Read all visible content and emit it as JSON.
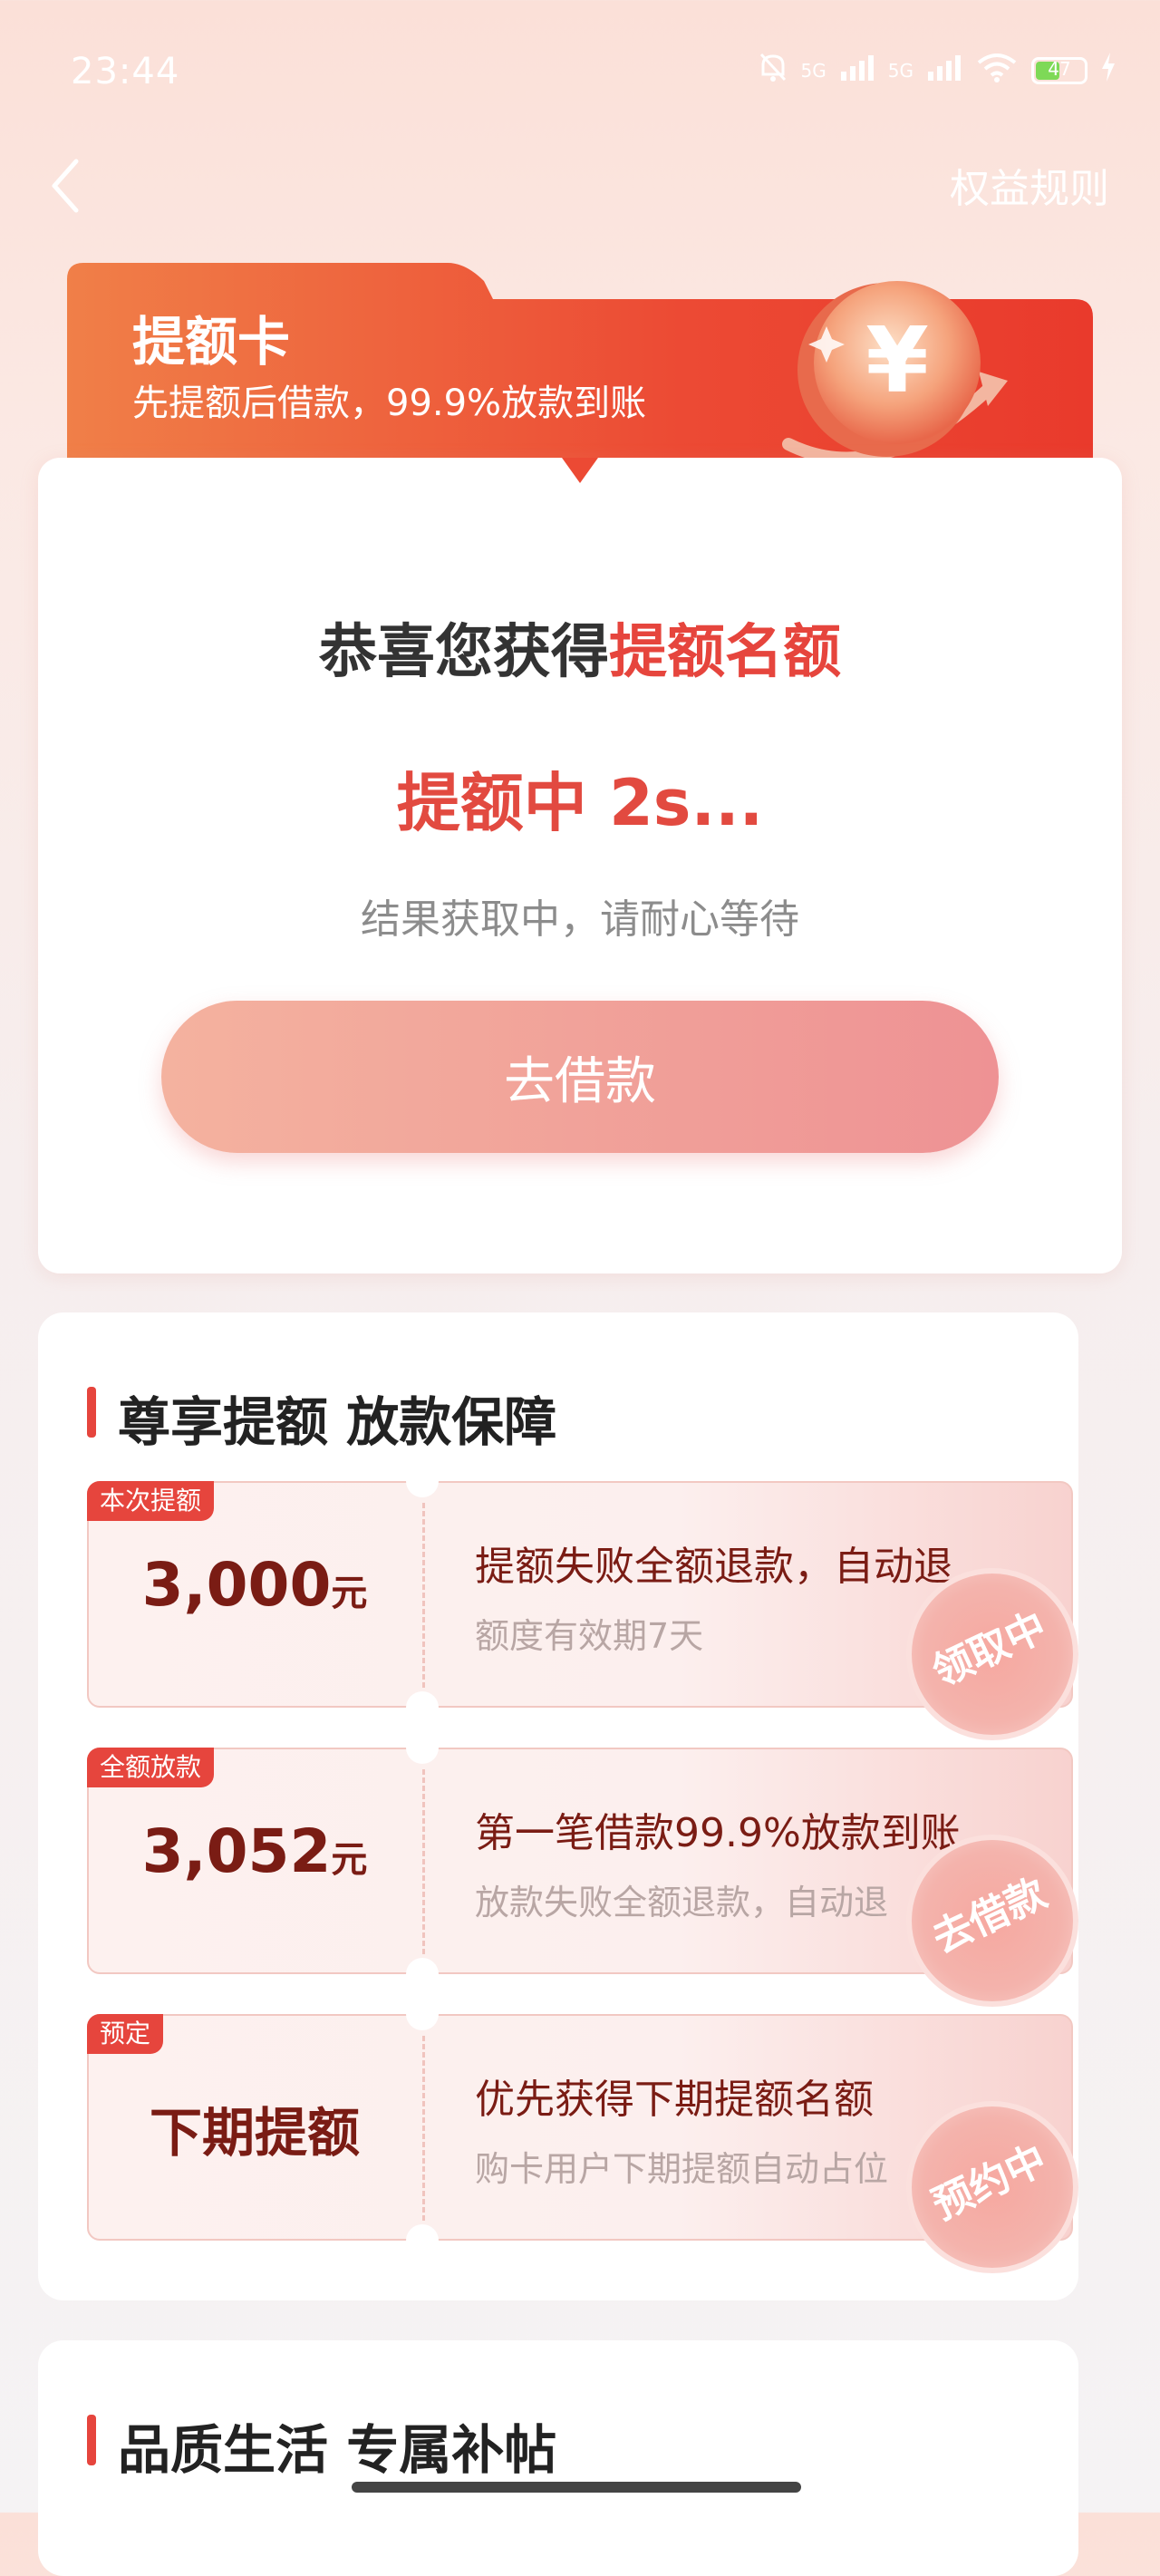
{
  "status_bar": {
    "time": "23:44",
    "network_1": "5G",
    "network_2": "5G",
    "battery": "47"
  },
  "nav": {
    "rules": "权益规则"
  },
  "header": {
    "title": "提额卡",
    "subtitle": "先提额后借款，99.9%放款到账"
  },
  "main": {
    "congrats_prefix": "恭喜您获得",
    "congrats_highlight": "提额名额",
    "status": "提额中 2s...",
    "hint": "结果获取中，请耐心等待",
    "button": "去借款"
  },
  "benefits": {
    "title": "尊享提额 放款保障",
    "tickets": [
      {
        "tag": "本次提额",
        "amount": "3,000",
        "unit": "元",
        "title": "提额失败全额退款，自动退",
        "desc": "额度有效期7天",
        "stamp": "领取中"
      },
      {
        "tag": "全额放款",
        "amount": "3,052",
        "unit": "元",
        "title": "第一笔借款99.9%放款到账",
        "desc": "放款失败全额退款，自动退",
        "stamp": "去借款"
      },
      {
        "tag": "预定",
        "amount": "下期提额",
        "unit": "",
        "title": "优先获得下期提额名额",
        "desc": "购卡用户下期提额自动占位",
        "stamp": "预约中"
      }
    ]
  },
  "section2": {
    "title": "品质生活 专属补帖"
  },
  "colors": {
    "accent": "#e6453d",
    "button": "#ee9294"
  }
}
